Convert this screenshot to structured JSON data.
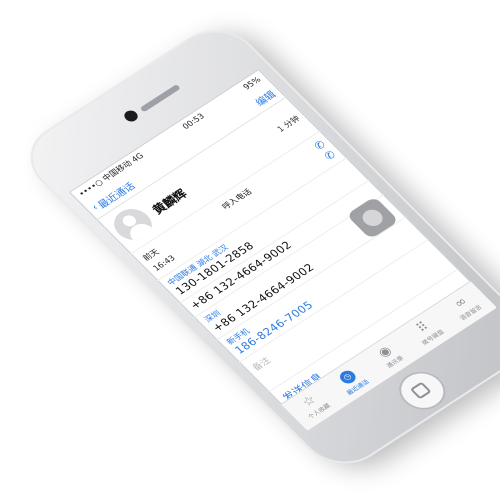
{
  "status_bar": {
    "signal": "••••○",
    "carrier": "中国移动",
    "network": "4G",
    "time": "00:53",
    "battery": "95%"
  },
  "nav": {
    "back_label": "最近通话",
    "edit_label": "编辑"
  },
  "contact": {
    "name": "黄麟辉",
    "duration": "1 分钟"
  },
  "call_log": {
    "day": "前天",
    "type": "呼入电话",
    "time": "16:43"
  },
  "numbers": [
    {
      "label": "中国联通 湖北 武汉",
      "value": "130-1801-2858"
    },
    {
      "label": "",
      "value": "+86 132-4664-9002"
    },
    {
      "label": "深圳",
      "value": "+86 132-4664-9002"
    },
    {
      "label": "新手机",
      "value": "186-8246-7005"
    }
  ],
  "notes_label": "备注",
  "send_message_label": "发送信息",
  "tabs": [
    {
      "label": "个人收藏",
      "icon": "star-icon"
    },
    {
      "label": "最近通话",
      "icon": "clock-icon",
      "active": true
    },
    {
      "label": "通讯录",
      "icon": "contacts-icon"
    },
    {
      "label": "拨号键盘",
      "icon": "keypad-icon"
    },
    {
      "label": "语音留言",
      "icon": "voicemail-icon"
    }
  ],
  "colors": {
    "accent": "#2d7be0",
    "phone_body": "#e3e4e6"
  }
}
